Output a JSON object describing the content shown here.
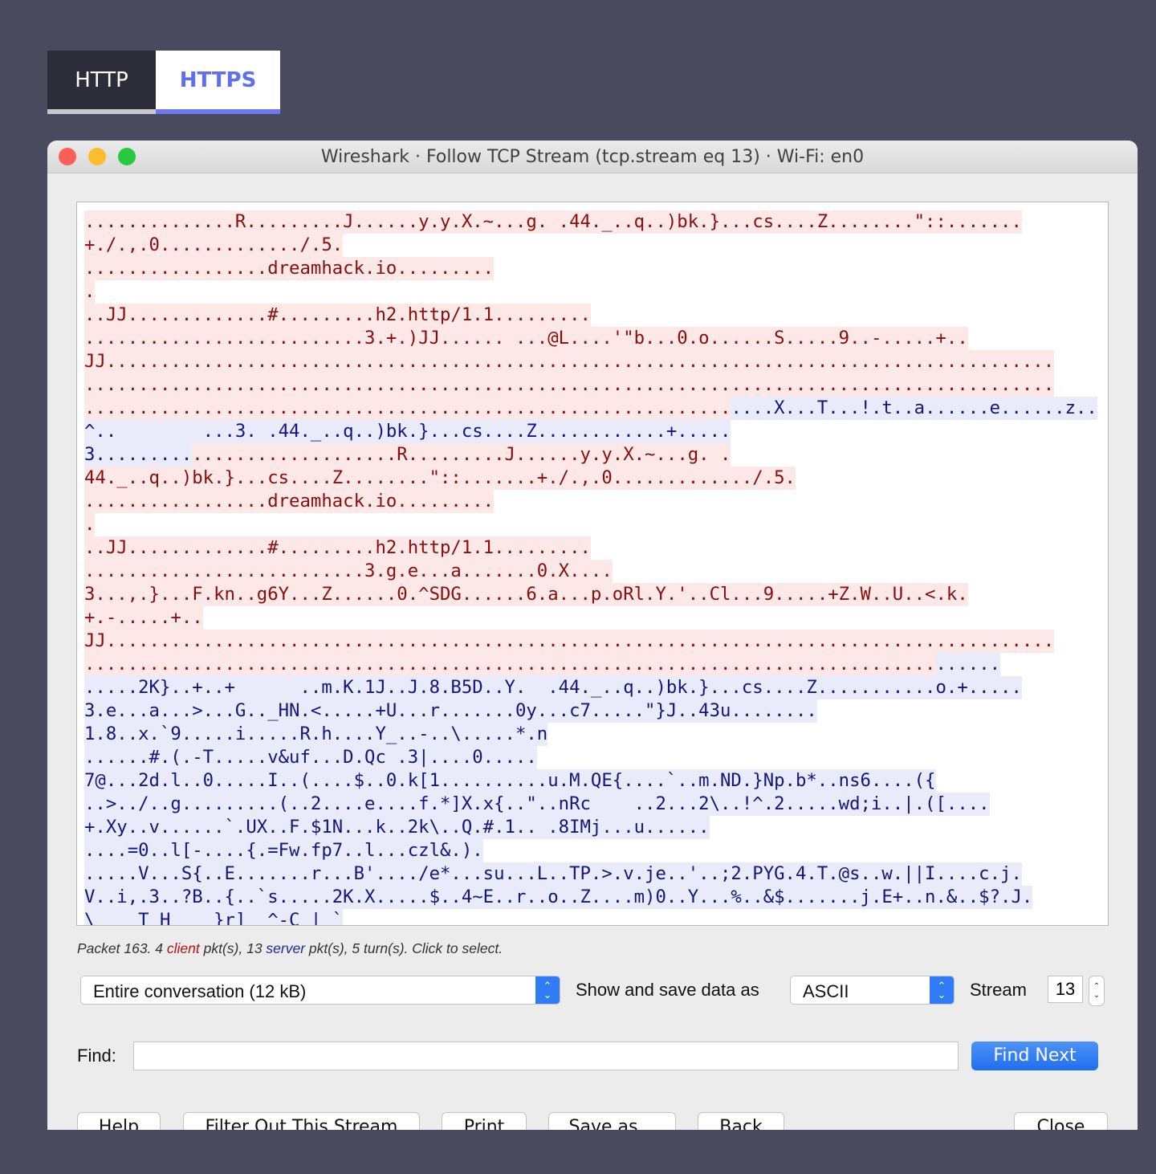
{
  "tabs": [
    {
      "label": "HTTP"
    },
    {
      "label": "HTTPS"
    }
  ],
  "window": {
    "title": "Wireshark · Follow TCP Stream (tcp.stream eq 13) · Wi-Fi: en0"
  },
  "stream_lines": [
    [
      [
        "c",
        "..............R.........J......y.y.X.~...g. .44._..q..)bk.}...cs....Z........\"::......."
      ]
    ],
    [
      [
        "c",
        "+./.,.0............./.5."
      ]
    ],
    [
      [
        "c",
        ".................dreamhack.io........."
      ]
    ],
    [
      [
        "c",
        "."
      ]
    ],
    [
      [
        "c",
        "..JJ.............#.........h2.http/1.1........."
      ]
    ],
    [
      [
        "c",
        "..........................3.+.)JJ...... ...@L....'\"b...0.o......S.....9..-.....+.."
      ]
    ],
    [
      [
        "c",
        "JJ........................................................................................"
      ]
    ],
    [
      [
        "c",
        ".........................................................................................."
      ]
    ],
    [
      [
        "c",
        "............................................................"
      ],
      [
        "s",
        "....X...T...!.t..a......e......z.."
      ]
    ],
    [
      [
        "s",
        "^..        ...3. .44._..q..)bk.}...cs....Z............+....."
      ]
    ],
    [
      [
        "s",
        "3........."
      ],
      [
        "c",
        "...................R.........J......y.y.X.~...g. ."
      ]
    ],
    [
      [
        "c",
        "44._..q..)bk.}...cs....Z........\"::.......+./.,.0............./.5."
      ]
    ],
    [
      [
        "c",
        ".................dreamhack.io........."
      ]
    ],
    [
      [
        "c",
        "."
      ]
    ],
    [
      [
        "c",
        "..JJ.............#.........h2.http/1.1........."
      ]
    ],
    [
      [
        "c",
        "..........................3.g.e...a.......0.X...."
      ]
    ],
    [
      [
        "c",
        "3...,.}...F.kn..g6Y...Z......0.^SDG......6.a...p.oRl.Y.'..Cl...9.....+Z.W..U..<.k."
      ]
    ],
    [
      [
        "c",
        "+.-.....+.."
      ]
    ],
    [
      [
        "c",
        "JJ........................................................................................"
      ]
    ],
    [
      [
        "c",
        "..............................................................................."
      ],
      [
        "s",
        "......"
      ]
    ],
    [
      [
        "s",
        ".....2K}..+..+      ..m.K.1J..J.8.B5D..Y.  .44._..q..)bk.}...cs....Z...........o.+....."
      ]
    ],
    [
      [
        "s",
        "3.e...a...>...G.._HN.<.....+U...r.......0y...c7.....\"}J..43u........"
      ]
    ],
    [
      [
        "s",
        "1.8..x.`9.....i.....R.h....Y_..-..\\.....*.n"
      ]
    ],
    [
      [
        "s",
        "......#.(.-T.....v&uf...D.Qc .3|....0....."
      ]
    ],
    [
      [
        "s",
        "7@...2d.l..0.....I..(....$..0.k[1..........u.M.QE{....`..m.ND.}Np.b*..ns6....({"
      ]
    ],
    [
      [
        "s",
        "..>../..g.........(..2....e....f.*]X.x{..\"..nRc    ..2...2\\..!^.2.....wd;i..|.([...."
      ]
    ],
    [
      [
        "s",
        "+.Xy..v......`.UX..F.$1N...k..2k\\..Q.#.1.. .8IMj...u......"
      ]
    ],
    [
      [
        "s",
        "....=0..l[-....{.=Fw.fp7..l...czl&.)."
      ]
    ],
    [
      [
        "s",
        ".....V...S{..E.......r...B'..../e*...su...L..TP.>.v.je..'..;2.PYG.4.T.@s..w.||I....c.j."
      ]
    ],
    [
      [
        "s",
        "V..i,.3..?B..{..`s.....2K.X.....$..4~E..r..o..Z....m)0..Y...%..&$.......j.E+..n.&..$?.J."
      ]
    ],
    [
      [
        "s",
        "\\    T H    }r]  ^-C | `"
      ]
    ]
  ],
  "status": {
    "prefix": "Packet 163. 4 ",
    "client": "client",
    "middle": " pkt(s), 13 ",
    "server": "server",
    "suffix": " pkt(s), 5 turn(s). Click to select."
  },
  "controls": {
    "conversation_value": "Entire conversation (12 kB)",
    "show_label": "Show and save data as",
    "format_value": "ASCII",
    "stream_label": "Stream",
    "stream_value": "13",
    "find_label": "Find:",
    "find_value": "",
    "find_next": "Find Next"
  },
  "buttons": {
    "help": "Help",
    "filter_out": "Filter Out This Stream",
    "print": "Print",
    "save_as": "Save as…",
    "back": "Back",
    "close": "Close"
  },
  "colors": {
    "client_bg": "#fde8e8",
    "client_fg": "#8b0c0c",
    "server_bg": "#e9ebfa",
    "server_fg": "#14157e",
    "accent": "#6d78ef"
  }
}
